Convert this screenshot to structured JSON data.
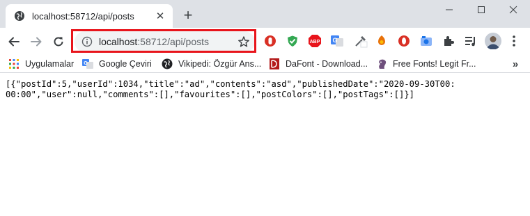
{
  "tab": {
    "title": "localhost:58712/api/posts",
    "favicon": "globe-icon",
    "close_glyph": "✕"
  },
  "new_tab_glyph": "+",
  "window_controls": [
    "minimize-icon",
    "maximize-icon",
    "close-icon"
  ],
  "toolbar": {
    "back_icon": "back-arrow-icon",
    "forward_icon": "forward-arrow-icon",
    "reload_icon": "reload-icon",
    "omnibox": {
      "host": "localhost",
      "rest": ":58712/api/posts",
      "info_icon": "info-icon",
      "star_icon": "star-icon"
    },
    "extensions": [
      {
        "name": "red-stop-extension-icon",
        "color": "#d93025"
      },
      {
        "name": "green-shield-extension-icon",
        "color": "#34a853"
      },
      {
        "name": "adblock-plus-icon",
        "label": "ABP",
        "color": "#e8141b"
      },
      {
        "name": "google-translate-icon",
        "color": "#4285f4"
      },
      {
        "name": "color-picker-icon",
        "color": "#5f6368"
      },
      {
        "name": "honey-extension-icon",
        "color": "#e8710a"
      },
      {
        "name": "opera-vpn-icon",
        "color": "#d93025"
      },
      {
        "name": "camera-extension-icon",
        "color": "#1a73e8"
      },
      {
        "name": "extensions-puzzle-icon",
        "color": "#5f6368"
      },
      {
        "name": "media-queue-icon",
        "color": "#5f6368"
      },
      {
        "name": "profile-avatar",
        "color": "#6f7f95"
      },
      {
        "name": "menu-kebab-icon",
        "color": "#5f6368"
      }
    ],
    "highlight_color": "#e8141b"
  },
  "bookmarks": [
    {
      "label": "Uygulamalar",
      "icon": "apps-grid-icon"
    },
    {
      "label": "Google Çeviri",
      "icon": "google-translate-icon"
    },
    {
      "label": "Vikipedi: Özgür Ans...",
      "icon": "wikipedia-icon"
    },
    {
      "label": "DaFont - Download...",
      "icon": "dafont-icon"
    },
    {
      "label": "Free Fonts! Legit Fr...",
      "icon": "font-squirrel-icon"
    }
  ],
  "bookmarks_more": "»",
  "content": {
    "json_text": "[{\"postId\":5,\"userId\":1034,\"title\":\"ad\",\"contents\":\"asd\",\"publishedDate\":\"2020-09-30T00:00:00\",\"user\":null,\"comments\":[],\"favourites\":[],\"postColors\":[],\"postTags\":[]}]"
  }
}
